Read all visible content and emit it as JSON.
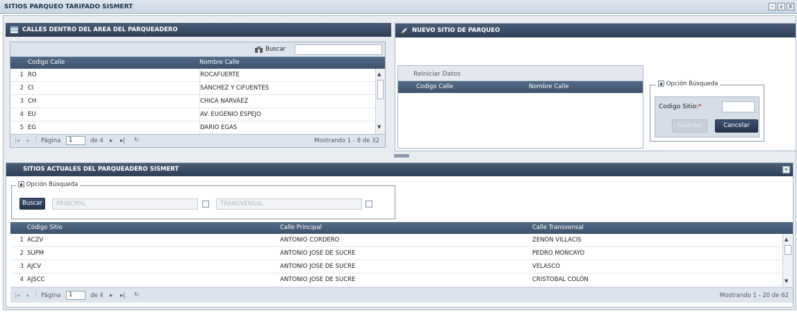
{
  "window": {
    "title": "SITIOS PARQUEO TARIFADO SISMERT",
    "min": "–",
    "restore": "ƨ",
    "close": "X"
  },
  "calles_panel": {
    "title": "CALLES DENTRO DEL AREA DEL PARQUEADERO",
    "search_label": "Buscar",
    "columns": [
      "Codigo Calle",
      "Nombre Calle"
    ],
    "rows": [
      {
        "n": "1",
        "code": "RO",
        "name": "ROCAFUERTE"
      },
      {
        "n": "2",
        "code": "CI",
        "name": "SÁNCHEZ Y CIFUENTES"
      },
      {
        "n": "3",
        "code": "CH",
        "name": "CHICA NARVÁEZ"
      },
      {
        "n": "4",
        "code": "EU",
        "name": "AV. EUGENIO ESPEJO"
      },
      {
        "n": "5",
        "code": "EG",
        "name": "DARIO EGAS"
      }
    ],
    "pager": {
      "page_label": "Página",
      "page": "1",
      "of": "de 4",
      "info": "Mostrando 1 - 8 de 32"
    }
  },
  "nuevo_panel": {
    "title": "NUEVO SITIO DE PARQUEO",
    "reset_label": "Reiniciar Datos",
    "columns": [
      "Codigo Calle",
      "Nombre Calle"
    ],
    "search_legend": "Opción Búsqueda",
    "codigo_label": "Codigo Sitio:",
    "required_mark": "*",
    "save_label": "Guardar",
    "cancel_label": "Cancelar"
  },
  "sitios_panel": {
    "title": "SITIOS ACTUALES DEL PARQUEADERO SISMERT",
    "search_legend": "Opción Búsqueda",
    "buscar_label": "Buscar",
    "principal_placeholder": "PRINCIPAL",
    "transversal_placeholder": "TRANSVENSAL",
    "columns": [
      "Código Sitio",
      "Calle Principal",
      "Calle Transvensal"
    ],
    "rows": [
      {
        "n": "1",
        "code": "ACZV",
        "principal": "ANTONIO CORDERO",
        "transversal": "ZENÓN VILLACIS"
      },
      {
        "n": "2",
        "code": "SUPM",
        "principal": "ANTONIO JOSE DE SUCRE",
        "transversal": "PEDRO MONCAYO"
      },
      {
        "n": "3",
        "code": "AJCV",
        "principal": "ANTONIO JOSE DE SUCRE",
        "transversal": "VELASCO"
      },
      {
        "n": "4",
        "code": "AJSCC",
        "principal": "ANTONIO JOSE DE SUCRE",
        "transversal": "CRISTOBAL COLÓN"
      }
    ],
    "pager": {
      "page_label": "Página",
      "page": "1",
      "of": "de 4",
      "info": "Mostrando 1 - 20 de 62"
    }
  }
}
